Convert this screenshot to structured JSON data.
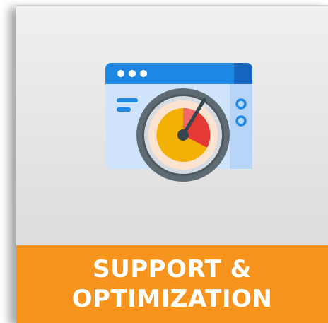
{
  "tile": {
    "title_line1": "SUPPORT &",
    "title_line2": "OPTIMIZATION",
    "icon": "browser-speedometer-icon",
    "colors": {
      "banner": "#f7941d",
      "banner_text": "#ffffff",
      "window_header": "#1e88e5",
      "window_body": "#cfe3fb",
      "gauge_ring": "#5f6b73",
      "gauge_face": "#fbe3cf",
      "gauge_yellow": "#f5b70a",
      "gauge_red": "#e53935",
      "needle": "#37474f"
    }
  }
}
